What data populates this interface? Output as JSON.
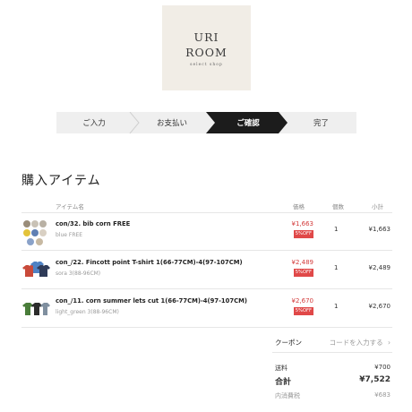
{
  "logo": {
    "line1": "URI",
    "line2": "ROOM",
    "line3": "select shop"
  },
  "steps": [
    {
      "label": "ご入力",
      "active": false
    },
    {
      "label": "お支払い",
      "active": false
    },
    {
      "label": "ご確認",
      "active": true
    },
    {
      "label": "完了",
      "active": false
    }
  ],
  "section_title": "購入アイテム",
  "table": {
    "headers": {
      "item": "アイテム名",
      "price": "価格",
      "qty": "個数",
      "subtotal": "小計"
    },
    "rows": [
      {
        "name": "con/32. bib corn FREE",
        "variant": "blue FREE",
        "price": "¥1,663",
        "badge": "5%OFF",
        "qty": "1",
        "subtotal": "¥1,663",
        "thumb_icon": "bib-product-image"
      },
      {
        "name": "con_/22. Fincott point T-shirt 1(66-77CM)-4(97-107CM)",
        "variant": "sora 3(88-96CM)",
        "price": "¥2,489",
        "badge": "5%OFF",
        "qty": "1",
        "subtotal": "¥2,489",
        "thumb_icon": "tshirt-product-image"
      },
      {
        "name": "con_/11. corn summer lets cut 1(66-77CM)-4(97-107CM)",
        "variant": "light_green 3(88-96CM)",
        "price": "¥2,670",
        "badge": "5%OFF",
        "qty": "1",
        "subtotal": "¥2,670",
        "thumb_icon": "summer-wear-product-image"
      }
    ]
  },
  "coupon": {
    "label": "クーポン",
    "placeholder": "コードを入力する",
    "chevron": "›"
  },
  "totals": {
    "shipping_label": "送料",
    "shipping_value": "¥700",
    "total_label": "合計",
    "total_value": "¥7,522",
    "tax_label": "内消費税",
    "tax_value": "¥683"
  },
  "colors": {
    "accent_red": "#d33b3b",
    "badge_red": "#e04848",
    "step_active": "#1c1c1c",
    "step_inactive": "#efefef",
    "logo_bg": "#f1ede6"
  }
}
